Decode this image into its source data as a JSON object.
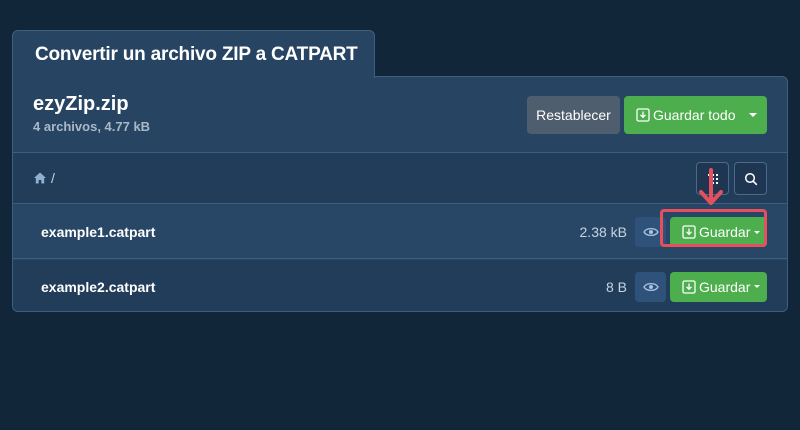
{
  "tab": {
    "title": "Convertir un archivo ZIP a CATPART"
  },
  "archive": {
    "name": "ezyZip.zip",
    "meta": "4 archivos, 4.77 kB"
  },
  "actions": {
    "reset_label": "Restablecer",
    "save_all_label": "Guardar todo"
  },
  "breadcrumb": {
    "path": "/"
  },
  "files": [
    {
      "name": "example1.catpart",
      "size": "2.38 kB",
      "save_label": "Guardar"
    },
    {
      "name": "example2.catpart",
      "size": "8 B",
      "save_label": "Guardar"
    }
  ],
  "icons": {
    "home": "home-icon",
    "list": "list-icon",
    "search": "search-icon",
    "eye": "eye-icon",
    "download": "download-icon",
    "caret": "caret-down-icon",
    "arrow": "arrow-down-icon"
  },
  "colors": {
    "background": "#12263a",
    "panel": "#274562",
    "primary": "#4cae4c",
    "secondary": "#4f5e6e",
    "highlight": "#e5505c"
  }
}
